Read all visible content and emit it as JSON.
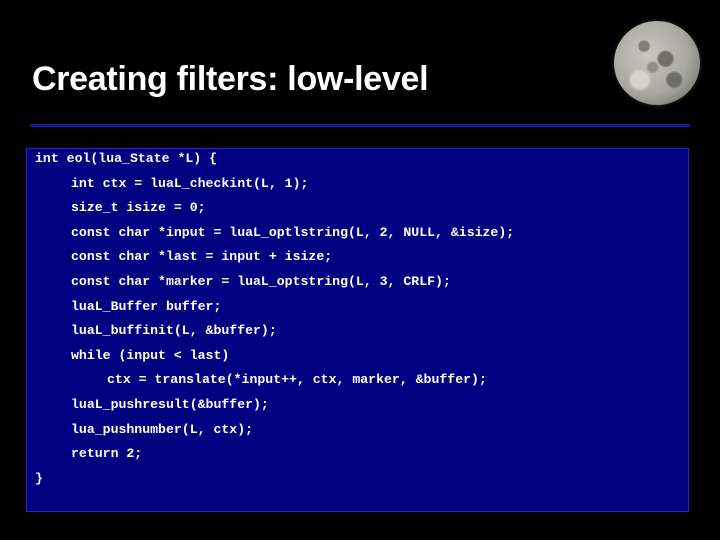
{
  "slide": {
    "title": "Creating filters: low-level",
    "colors": {
      "background": "#000000",
      "code_background": "#000080",
      "divider": "#1a1aa0",
      "text": "#ffffff"
    },
    "image": "moon-image"
  },
  "code": {
    "lines": [
      {
        "indent": 0,
        "text": "int eol(lua_State *L) {"
      },
      {
        "indent": 1,
        "text": "int ctx = luaL_checkint(L, 1);"
      },
      {
        "indent": 1,
        "text": "size_t isize = 0;"
      },
      {
        "indent": 1,
        "text": "const char *input = luaL_optlstring(L, 2, NULL, &isize);"
      },
      {
        "indent": 1,
        "text": "const char *last = input + isize;"
      },
      {
        "indent": 1,
        "text": "const char *marker = luaL_optstring(L, 3, CRLF);"
      },
      {
        "indent": 1,
        "text": "luaL_Buffer buffer;"
      },
      {
        "indent": 1,
        "text": "luaL_buffinit(L, &buffer);"
      },
      {
        "indent": 1,
        "text": "while (input < last)"
      },
      {
        "indent": 2,
        "text": "ctx = translate(*input++, ctx, marker, &buffer);"
      },
      {
        "indent": 1,
        "text": "luaL_pushresult(&buffer);"
      },
      {
        "indent": 1,
        "text": "lua_pushnumber(L, ctx);"
      },
      {
        "indent": 1,
        "text": "return 2;"
      },
      {
        "indent": 0,
        "text": "}"
      }
    ]
  }
}
